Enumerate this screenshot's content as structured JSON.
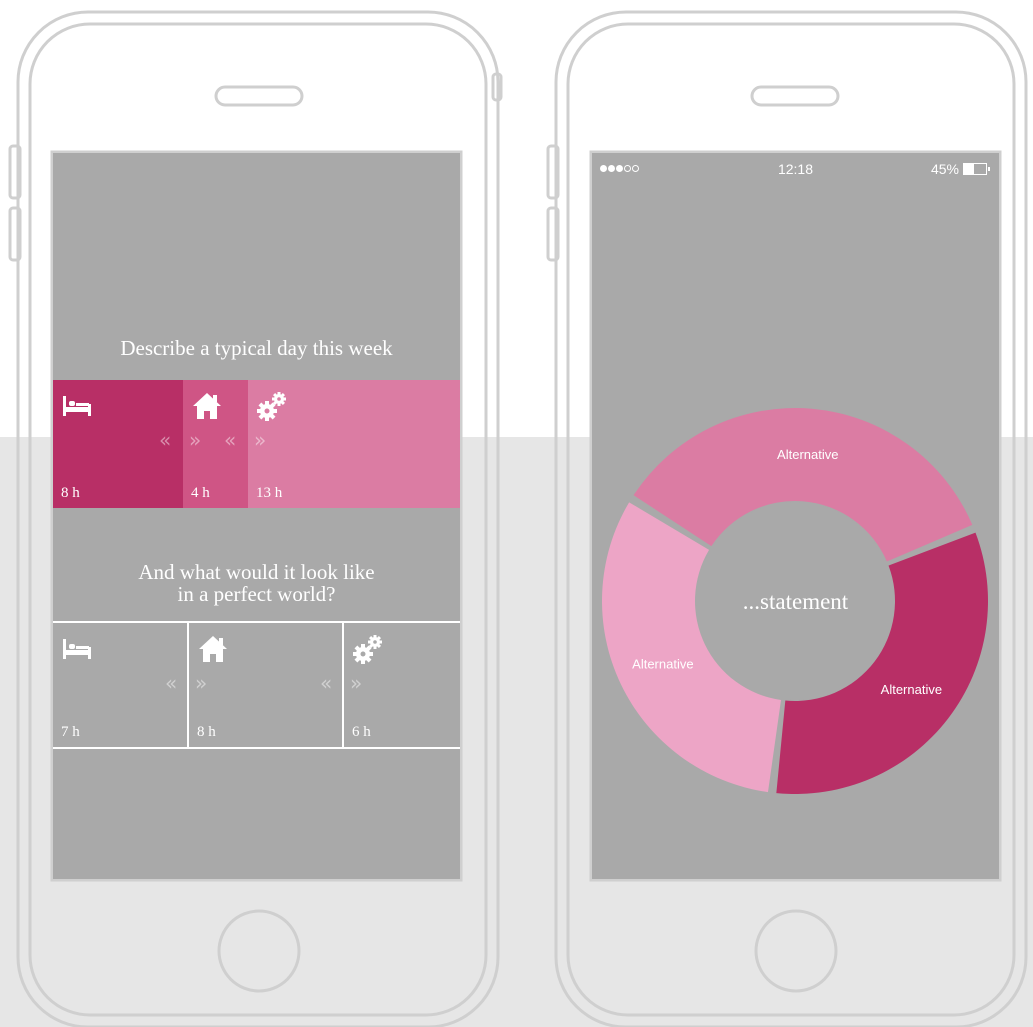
{
  "colors": {
    "screen_bg": "#a9a9a9",
    "magenta_dark": "#b82f66",
    "magenta_mid": "#cf5585",
    "pink": "#db7ca3",
    "pink_light": "#eda5c6",
    "white": "#ffffff"
  },
  "left_phone": {
    "question_typical": "Describe a typical day this week",
    "question_perfect": "And what would it look like\nin a perfect world?",
    "typical_day": [
      {
        "icon": "bed-icon",
        "hours_label": "8 h",
        "hours": 8
      },
      {
        "icon": "home-icon",
        "hours_label": "4 h",
        "hours": 4
      },
      {
        "icon": "gears-icon",
        "hours_label": "13 h",
        "hours": 13
      }
    ],
    "perfect_day": [
      {
        "icon": "bed-icon",
        "hours_label": "7 h",
        "hours": 7
      },
      {
        "icon": "home-icon",
        "hours_label": "8 h",
        "hours": 8
      },
      {
        "icon": "gears-icon",
        "hours_label": "6 h",
        "hours": 6
      }
    ],
    "handle_left": "«",
    "handle_right": "»"
  },
  "right_phone": {
    "status_bar": {
      "time": "12:18",
      "battery": "45%",
      "battery_level": 0.45,
      "signal_dots_filled": 3,
      "signal_dots_total": 5
    },
    "center_text": "...statement",
    "donut_segments": [
      {
        "label": "Alternative",
        "color": "#db7ca3",
        "share": 0.35
      },
      {
        "label": "Alternative",
        "color": "#b82f66",
        "share": 0.33
      },
      {
        "label": "Alternative",
        "color": "#eda5c6",
        "share": 0.32
      }
    ]
  }
}
